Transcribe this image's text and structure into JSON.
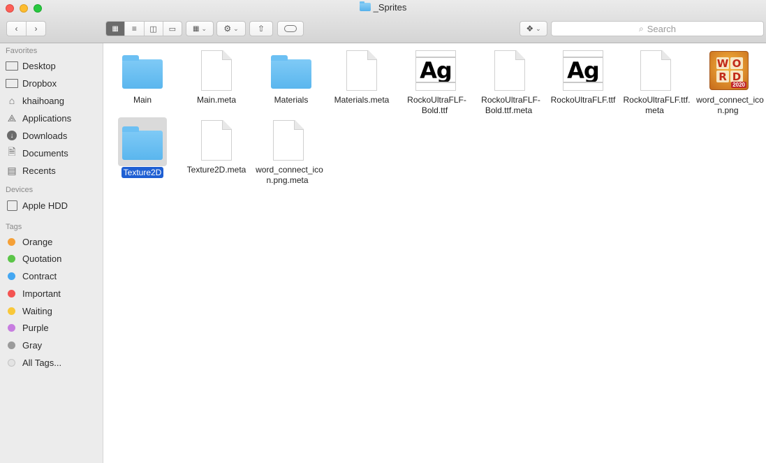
{
  "window": {
    "title": "_Sprites"
  },
  "toolbar": {
    "search_placeholder": "Search"
  },
  "sidebar": {
    "favorites_header": "Favorites",
    "favorites": [
      {
        "label": "Desktop",
        "icon": "desktop-icon"
      },
      {
        "label": "Dropbox",
        "icon": "folder-icon"
      },
      {
        "label": "khaihoang",
        "icon": "home-icon"
      },
      {
        "label": "Applications",
        "icon": "applications-icon"
      },
      {
        "label": "Downloads",
        "icon": "downloads-icon"
      },
      {
        "label": "Documents",
        "icon": "documents-icon"
      },
      {
        "label": "Recents",
        "icon": "recents-icon"
      }
    ],
    "devices_header": "Devices",
    "devices": [
      {
        "label": "Apple HDD",
        "icon": "harddisk-icon"
      }
    ],
    "tags_header": "Tags",
    "tags": [
      {
        "label": "Orange",
        "color": "#f5a037"
      },
      {
        "label": "Quotation",
        "color": "#5bc548"
      },
      {
        "label": "Contract",
        "color": "#44a7f2"
      },
      {
        "label": "Important",
        "color": "#f45452"
      },
      {
        "label": "Waiting",
        "color": "#f9c83a"
      },
      {
        "label": "Purple",
        "color": "#c77de0"
      },
      {
        "label": "Gray",
        "color": "#9b9b9b"
      },
      {
        "label": "All Tags...",
        "color": "#d8d8d8"
      }
    ]
  },
  "files": [
    {
      "name": "Main",
      "type": "folder"
    },
    {
      "name": "Main.meta",
      "type": "document"
    },
    {
      "name": "Materials",
      "type": "folder"
    },
    {
      "name": "Materials.meta",
      "type": "document"
    },
    {
      "name": "RockoUltraFLF-Bold.ttf",
      "type": "font",
      "preview": "Ag"
    },
    {
      "name": "RockoUltraFLF-Bold.ttf.meta",
      "type": "document"
    },
    {
      "name": "RockoUltraFLF.ttf",
      "type": "font",
      "preview": "Ag"
    },
    {
      "name": "RockoUltraFLF.ttf.meta",
      "type": "document"
    },
    {
      "name": "word_connect_icon.png",
      "type": "image",
      "tiles": [
        "W",
        "O",
        "R",
        "D"
      ],
      "badge": "2020"
    },
    {
      "name": "Texture2D",
      "type": "folder",
      "selected": true
    },
    {
      "name": "Texture2D.meta",
      "type": "document"
    },
    {
      "name": "word_connect_icon.png.meta",
      "type": "document"
    }
  ]
}
